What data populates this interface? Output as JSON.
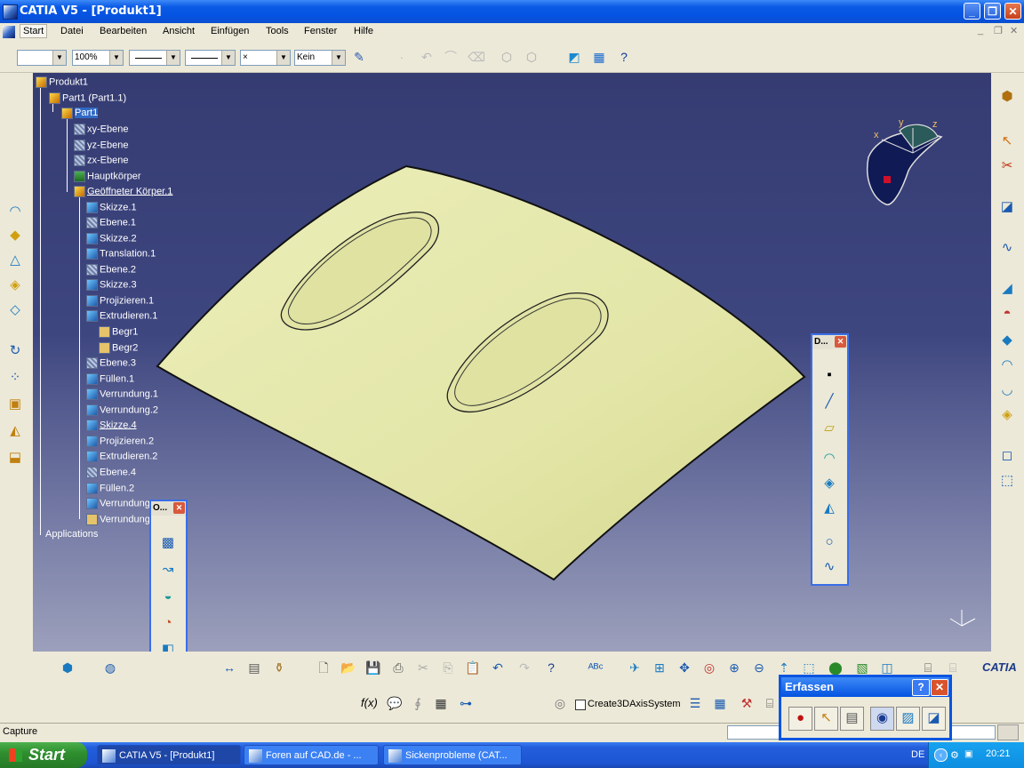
{
  "window": {
    "title": "CATIA V5 - [Produkt1]"
  },
  "menu": [
    "Start",
    "Datei",
    "Bearbeiten",
    "Ansicht",
    "Einfügen",
    "Tools",
    "Fenster",
    "Hilfe"
  ],
  "toolbar": {
    "zoom": "100%",
    "layer_filter": "Kein",
    "line_width_symbol": "×"
  },
  "tree": {
    "root": "Produkt1",
    "part_instance": "Part1 (Part1.1)",
    "part": "Part1",
    "planes": [
      "xy-Ebene",
      "yz-Ebene",
      "zx-Ebene"
    ],
    "main_body": "Hauptkörper",
    "open_body": "Geöffneter Körper.1",
    "items": [
      "Skizze.1",
      "Ebene.1",
      "Skizze.2",
      "Translation.1",
      "Ebene.2",
      "Skizze.3",
      "Projizieren.1",
      "Extrudieren.1"
    ],
    "limits": [
      "Begr1",
      "Begr2"
    ],
    "items2": [
      "Ebene.3",
      "Füllen.1",
      "Verrundung.1",
      "Verrundung.2",
      "Skizze.4",
      "Projizieren.2",
      "Extrudieren.2",
      "Ebene.4",
      "Füllen.2",
      "Verrundung",
      "Verrundung"
    ],
    "applications": "Applications"
  },
  "compass": {
    "x": "x",
    "y": "y",
    "z": "z"
  },
  "floating_toolbar_1": {
    "title": "O..."
  },
  "floating_toolbar_2": {
    "title": "D..."
  },
  "bottom": {
    "axis_checkbox_label": "Create3DAxisSystem",
    "fx_label": "f(x)"
  },
  "status": {
    "text": "Capture"
  },
  "capture_panel": {
    "title": "Erfassen",
    "help": "?"
  },
  "taskbar": {
    "start": "Start",
    "tasks": [
      "CATIA V5 - [Produkt1]",
      "Foren auf CAD.de - ...",
      "Sickenprobleme (CAT..."
    ],
    "lang": "DE",
    "clock": "20:21"
  },
  "brand": "CATIA"
}
